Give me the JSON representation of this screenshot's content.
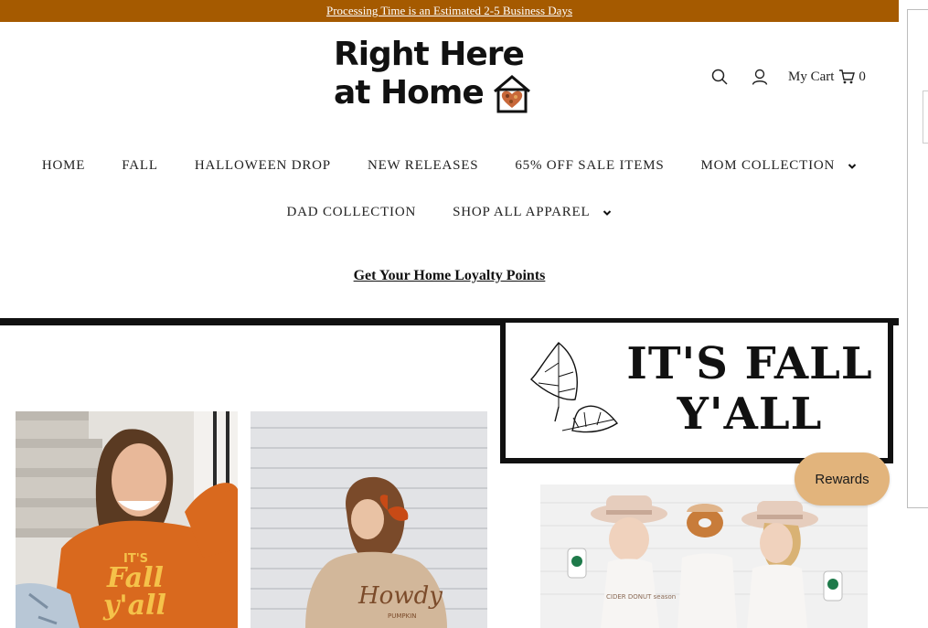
{
  "announcement": {
    "text": "Processing Time is an Estimated 2-5 Business Days"
  },
  "logo": {
    "line1": "Right Here",
    "line2": "at Home"
  },
  "header": {
    "search_icon": "search-icon",
    "account_icon": "account-icon",
    "cart_label": "My Cart",
    "cart_icon": "cart-icon",
    "cart_count": "0"
  },
  "nav": {
    "row1": [
      {
        "label": "HOME"
      },
      {
        "label": "FALL"
      },
      {
        "label": "HALLOWEEN DROP"
      },
      {
        "label": "NEW RELEASES"
      },
      {
        "label": "65% OFF SALE ITEMS"
      },
      {
        "label": "MOM COLLECTION",
        "dropdown": true
      }
    ],
    "row2": [
      {
        "label": "DAD COLLECTION"
      },
      {
        "label": "SHOP ALL APPAREL",
        "dropdown": true
      }
    ]
  },
  "loyalty": {
    "link": "Get Your Home Loyalty Points"
  },
  "banner": {
    "line1": "IT'S FALL",
    "line2": "Y'ALL"
  },
  "products": [
    {
      "print_line1": "IT'S",
      "print_line2": "Fall",
      "print_line3": "y'all"
    },
    {
      "print_line1": "Howdy",
      "print_line2": "PUMPKIN"
    },
    {
      "print": "CIDER DONUT season"
    }
  ],
  "rewards": {
    "label": "Rewards"
  },
  "colors": {
    "announcement_bg": "#a55a00",
    "rewards_bg": "#e2b47c",
    "accent_orange": "#d9691e"
  }
}
